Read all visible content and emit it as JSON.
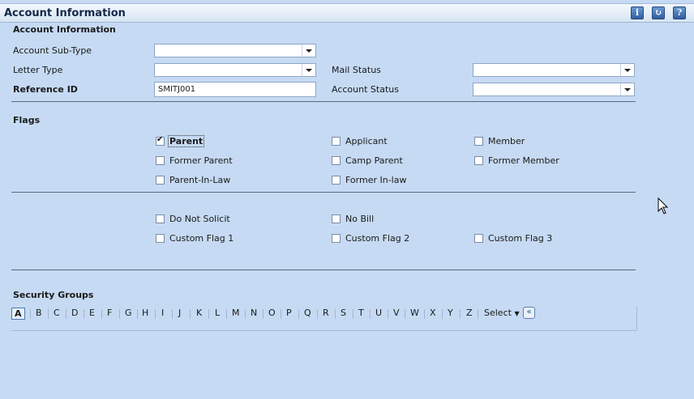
{
  "header": {
    "title": "Account Information",
    "icons": [
      "info-icon",
      "refresh-icon",
      "help-icon"
    ]
  },
  "account_info": {
    "heading": "Account Information",
    "sub_type_label": "Account Sub-Type",
    "sub_type_value": "",
    "letter_type_label": "Letter Type",
    "letter_type_value": "",
    "reference_id_label": "Reference ID",
    "reference_id_value": "SMITJ001",
    "mail_status_label": "Mail Status",
    "mail_status_value": "",
    "account_status_label": "Account Status",
    "account_status_value": ""
  },
  "flags": {
    "heading": "Flags",
    "items": [
      {
        "label": "Parent",
        "checked": true
      },
      {
        "label": "Applicant",
        "checked": false
      },
      {
        "label": "Member",
        "checked": false
      },
      {
        "label": "Former Parent",
        "checked": false
      },
      {
        "label": "Camp Parent",
        "checked": false
      },
      {
        "label": "Former Member",
        "checked": false
      },
      {
        "label": "Parent-In-Law",
        "checked": false
      },
      {
        "label": "Former In-law",
        "checked": false
      }
    ],
    "extra": [
      {
        "label": "Do Not Solicit",
        "checked": false
      },
      {
        "label": "No Bill",
        "checked": false
      },
      {
        "label": "Custom Flag 1",
        "checked": false
      },
      {
        "label": "Custom Flag 2",
        "checked": false
      },
      {
        "label": "Custom Flag 3",
        "checked": false
      }
    ]
  },
  "security": {
    "heading": "Security Groups",
    "letters": [
      "A",
      "B",
      "C",
      "D",
      "E",
      "F",
      "G",
      "H",
      "I",
      "J",
      "K",
      "L",
      "M",
      "N",
      "O",
      "P",
      "Q",
      "R",
      "S",
      "T",
      "U",
      "V",
      "W",
      "X",
      "Y",
      "Z"
    ],
    "active_letter": "A",
    "select_label": "Select",
    "rewind_glyph": "«"
  }
}
